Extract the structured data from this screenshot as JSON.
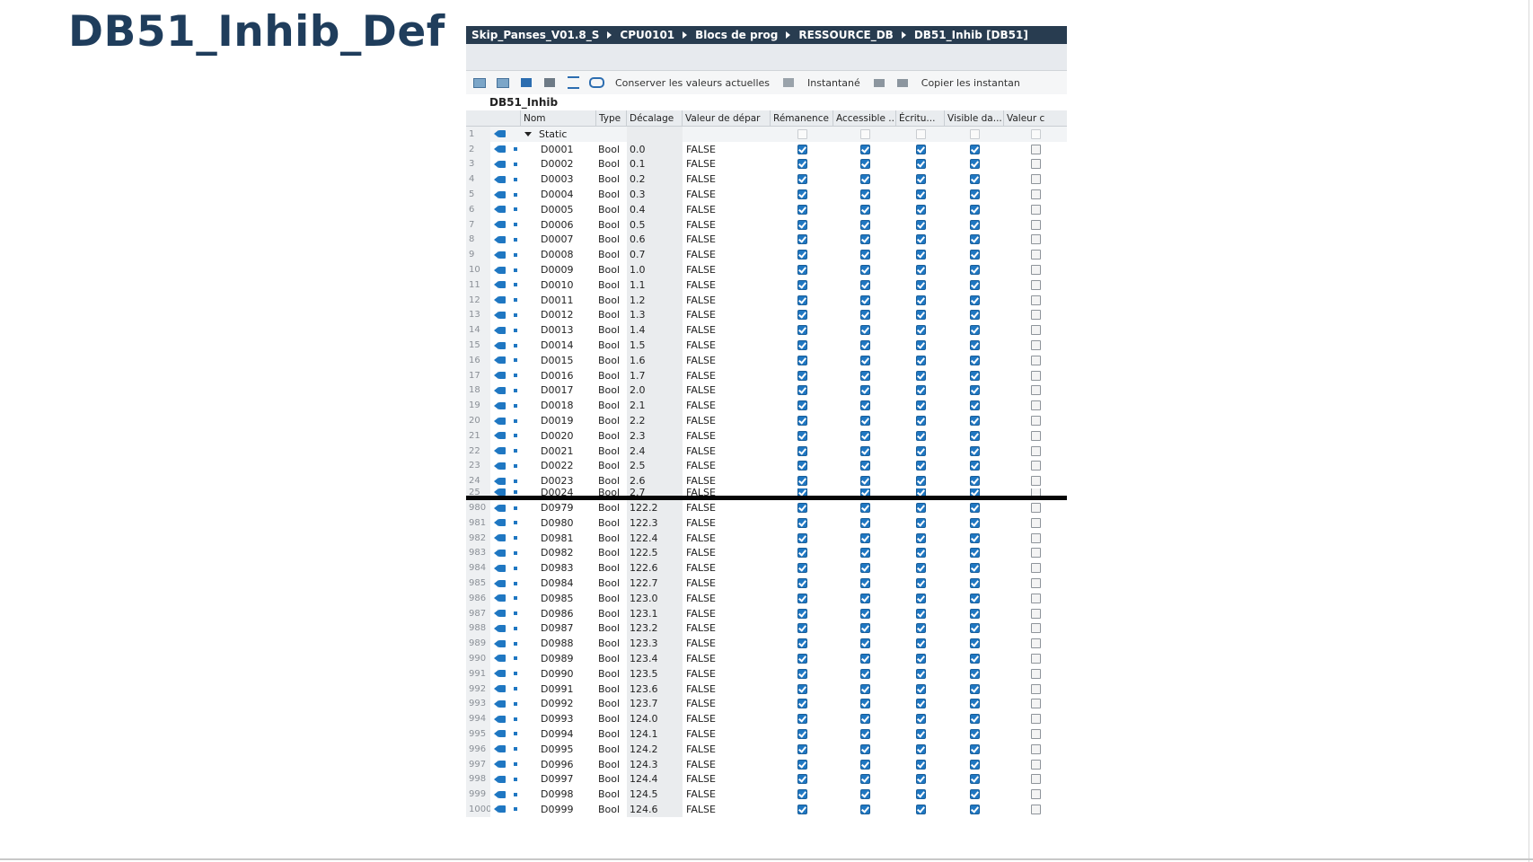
{
  "slide": {
    "title": "DB51_Inhib_Def"
  },
  "breadcrumb": [
    "Skip_Panses_V01.8_S",
    "CPU0101",
    "Blocs de prog",
    "RESSOURCE_DB",
    "DB51_Inhib [DB51]"
  ],
  "toolbar": {
    "keep_values_label": "Conserver les valeurs actuelles",
    "snapshot_label": "Instantané",
    "copy_snapshot_label": "Copier les instantan"
  },
  "db_name": "DB51_Inhib",
  "columns": {
    "name": "Nom",
    "type": "Type",
    "offset": "Décalage",
    "start_value": "Valeur de dépar",
    "retain": "Rémanence",
    "accessible": "Accessible ...",
    "writable": "Écritu...",
    "visible": "Visible da...",
    "setpoint": "Valeur c"
  },
  "static_row": {
    "num": "1",
    "label": "Static"
  },
  "rows_top": [
    {
      "num": "2",
      "name": "D0001",
      "type": "Bool",
      "offset": "0.0",
      "value": "FALSE"
    },
    {
      "num": "3",
      "name": "D0002",
      "type": "Bool",
      "offset": "0.1",
      "value": "FALSE"
    },
    {
      "num": "4",
      "name": "D0003",
      "type": "Bool",
      "offset": "0.2",
      "value": "FALSE"
    },
    {
      "num": "5",
      "name": "D0004",
      "type": "Bool",
      "offset": "0.3",
      "value": "FALSE"
    },
    {
      "num": "6",
      "name": "D0005",
      "type": "Bool",
      "offset": "0.4",
      "value": "FALSE"
    },
    {
      "num": "7",
      "name": "D0006",
      "type": "Bool",
      "offset": "0.5",
      "value": "FALSE"
    },
    {
      "num": "8",
      "name": "D0007",
      "type": "Bool",
      "offset": "0.6",
      "value": "FALSE"
    },
    {
      "num": "9",
      "name": "D0008",
      "type": "Bool",
      "offset": "0.7",
      "value": "FALSE"
    },
    {
      "num": "10",
      "name": "D0009",
      "type": "Bool",
      "offset": "1.0",
      "value": "FALSE"
    },
    {
      "num": "11",
      "name": "D0010",
      "type": "Bool",
      "offset": "1.1",
      "value": "FALSE"
    },
    {
      "num": "12",
      "name": "D0011",
      "type": "Bool",
      "offset": "1.2",
      "value": "FALSE"
    },
    {
      "num": "13",
      "name": "D0012",
      "type": "Bool",
      "offset": "1.3",
      "value": "FALSE"
    },
    {
      "num": "14",
      "name": "D0013",
      "type": "Bool",
      "offset": "1.4",
      "value": "FALSE"
    },
    {
      "num": "15",
      "name": "D0014",
      "type": "Bool",
      "offset": "1.5",
      "value": "FALSE"
    },
    {
      "num": "16",
      "name": "D0015",
      "type": "Bool",
      "offset": "1.6",
      "value": "FALSE"
    },
    {
      "num": "17",
      "name": "D0016",
      "type": "Bool",
      "offset": "1.7",
      "value": "FALSE"
    },
    {
      "num": "18",
      "name": "D0017",
      "type": "Bool",
      "offset": "2.0",
      "value": "FALSE"
    },
    {
      "num": "19",
      "name": "D0018",
      "type": "Bool",
      "offset": "2.1",
      "value": "FALSE"
    },
    {
      "num": "20",
      "name": "D0019",
      "type": "Bool",
      "offset": "2.2",
      "value": "FALSE"
    },
    {
      "num": "21",
      "name": "D0020",
      "type": "Bool",
      "offset": "2.3",
      "value": "FALSE"
    },
    {
      "num": "22",
      "name": "D0021",
      "type": "Bool",
      "offset": "2.4",
      "value": "FALSE"
    },
    {
      "num": "23",
      "name": "D0022",
      "type": "Bool",
      "offset": "2.5",
      "value": "FALSE"
    },
    {
      "num": "24",
      "name": "D0023",
      "type": "Bool",
      "offset": "2.6",
      "value": "FALSE"
    },
    {
      "num": "25",
      "name": "D0024",
      "type": "Bool",
      "offset": "2.7",
      "value": "FALSE"
    }
  ],
  "rows_bottom": [
    {
      "num": "980",
      "name": "D0979",
      "type": "Bool",
      "offset": "122.2",
      "value": "FALSE"
    },
    {
      "num": "981",
      "name": "D0980",
      "type": "Bool",
      "offset": "122.3",
      "value": "FALSE"
    },
    {
      "num": "982",
      "name": "D0981",
      "type": "Bool",
      "offset": "122.4",
      "value": "FALSE"
    },
    {
      "num": "983",
      "name": "D0982",
      "type": "Bool",
      "offset": "122.5",
      "value": "FALSE"
    },
    {
      "num": "984",
      "name": "D0983",
      "type": "Bool",
      "offset": "122.6",
      "value": "FALSE"
    },
    {
      "num": "985",
      "name": "D0984",
      "type": "Bool",
      "offset": "122.7",
      "value": "FALSE"
    },
    {
      "num": "986",
      "name": "D0985",
      "type": "Bool",
      "offset": "123.0",
      "value": "FALSE"
    },
    {
      "num": "987",
      "name": "D0986",
      "type": "Bool",
      "offset": "123.1",
      "value": "FALSE"
    },
    {
      "num": "988",
      "name": "D0987",
      "type": "Bool",
      "offset": "123.2",
      "value": "FALSE"
    },
    {
      "num": "989",
      "name": "D0988",
      "type": "Bool",
      "offset": "123.3",
      "value": "FALSE"
    },
    {
      "num": "990",
      "name": "D0989",
      "type": "Bool",
      "offset": "123.4",
      "value": "FALSE"
    },
    {
      "num": "991",
      "name": "D0990",
      "type": "Bool",
      "offset": "123.5",
      "value": "FALSE"
    },
    {
      "num": "992",
      "name": "D0991",
      "type": "Bool",
      "offset": "123.6",
      "value": "FALSE"
    },
    {
      "num": "993",
      "name": "D0992",
      "type": "Bool",
      "offset": "123.7",
      "value": "FALSE"
    },
    {
      "num": "994",
      "name": "D0993",
      "type": "Bool",
      "offset": "124.0",
      "value": "FALSE"
    },
    {
      "num": "995",
      "name": "D0994",
      "type": "Bool",
      "offset": "124.1",
      "value": "FALSE"
    },
    {
      "num": "996",
      "name": "D0995",
      "type": "Bool",
      "offset": "124.2",
      "value": "FALSE"
    },
    {
      "num": "997",
      "name": "D0996",
      "type": "Bool",
      "offset": "124.3",
      "value": "FALSE"
    },
    {
      "num": "998",
      "name": "D0997",
      "type": "Bool",
      "offset": "124.4",
      "value": "FALSE"
    },
    {
      "num": "999",
      "name": "D0998",
      "type": "Bool",
      "offset": "124.5",
      "value": "FALSE"
    },
    {
      "num": "1000",
      "name": "D0999",
      "type": "Bool",
      "offset": "124.6",
      "value": "FALSE"
    }
  ],
  "colors": {
    "title": "#1f3d5c",
    "breadcrumb_bg": "#283c50",
    "checkbox": "#1f77c2"
  }
}
